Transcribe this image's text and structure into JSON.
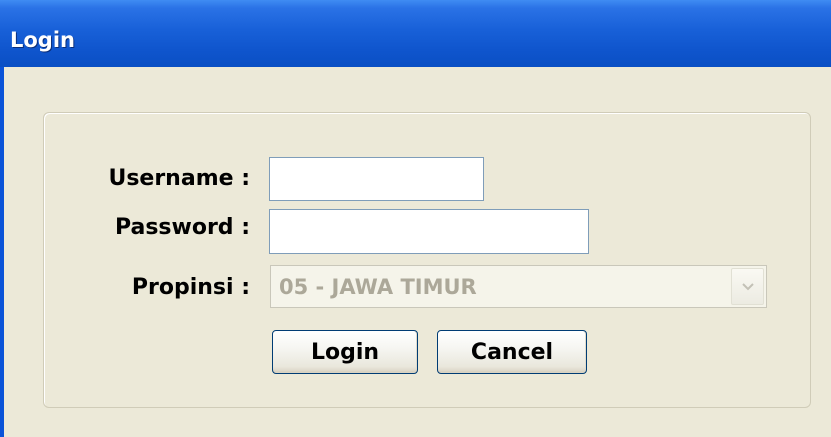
{
  "window": {
    "title": "Login"
  },
  "form": {
    "username": {
      "label": "Username :",
      "value": ""
    },
    "password": {
      "label": "Password :",
      "value": ""
    },
    "propinsi": {
      "label": "Propinsi :",
      "selected": "05 - JAWA TIMUR",
      "disabled": true
    }
  },
  "buttons": {
    "login_label": "Login",
    "cancel_label": "Cancel"
  },
  "colors": {
    "titlebar": "#0a53d8",
    "window_bg": "#ece9d8",
    "disabled_text": "#aca899",
    "button_border": "#003c74"
  },
  "icons": {
    "dropdown": "chevron-down-icon"
  }
}
